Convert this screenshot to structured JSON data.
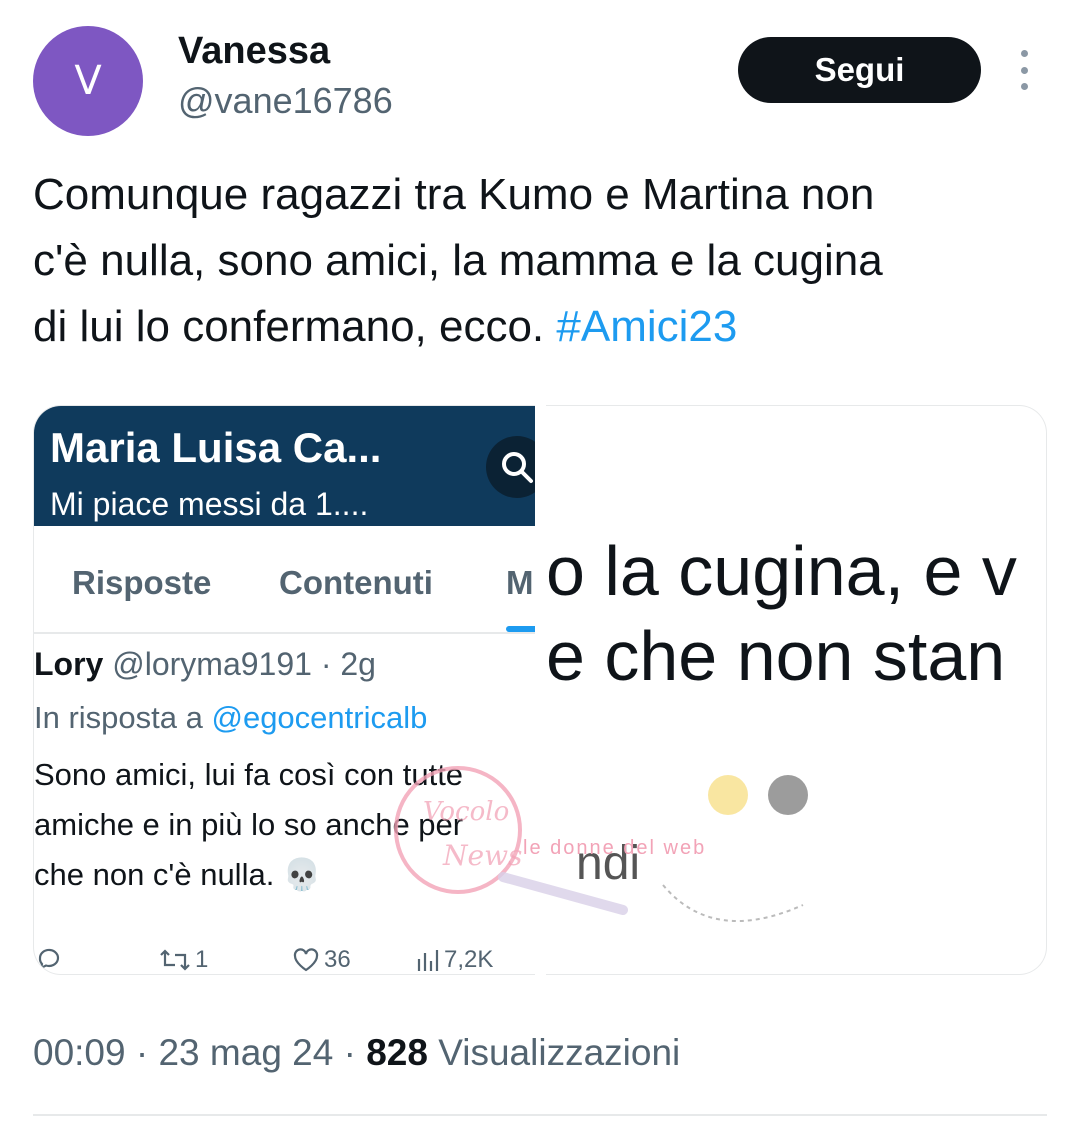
{
  "author": {
    "avatar_letter": "V",
    "avatar_color": "#7e57c2",
    "name": "Vanessa",
    "handle": "@vane16786"
  },
  "follow_button": {
    "label": "Segui"
  },
  "more_icon": "vertical-ellipsis-icon",
  "tweet": {
    "text_line1": "Comunque ragazzi tra Kumo e Martina non",
    "text_line2": "c'è nulla, sono amici, la mamma e la cugina",
    "text_line3": "di lui lo confermano, ecco. ",
    "hashtag": "#Amici23",
    "hashtag_color": "#1d9bf0"
  },
  "media_left": {
    "profile_name": "Maria Luisa Ca...",
    "profile_likes": "Mi piace messi da 1....",
    "tabs": [
      "Risposte",
      "Contenuti",
      "M"
    ],
    "reply": {
      "author_name": "Lory",
      "author_handle": "@loryma9191 · 2g",
      "reply_to_prefix": "In risposta a ",
      "reply_to_mention": "@egocentricalb",
      "text_line1": "Sono amici, lui fa così con tutte",
      "text_line2": "amiche e in più lo so anche per",
      "text_line3": "che non c'è nulla. 💀",
      "retweets": "1",
      "likes": "36",
      "views": "7,2K"
    }
  },
  "media_right": {
    "line1": "o la cugina, e v",
    "line2": "e che non stan",
    "partial": "ndi"
  },
  "watermark": {
    "script_text": "Vocolo della News",
    "ribbon_text": "le donne del web"
  },
  "footer": {
    "time": "00:09",
    "date": "23 mag 24",
    "views_count": "828",
    "views_label": "Visualizzazioni"
  }
}
